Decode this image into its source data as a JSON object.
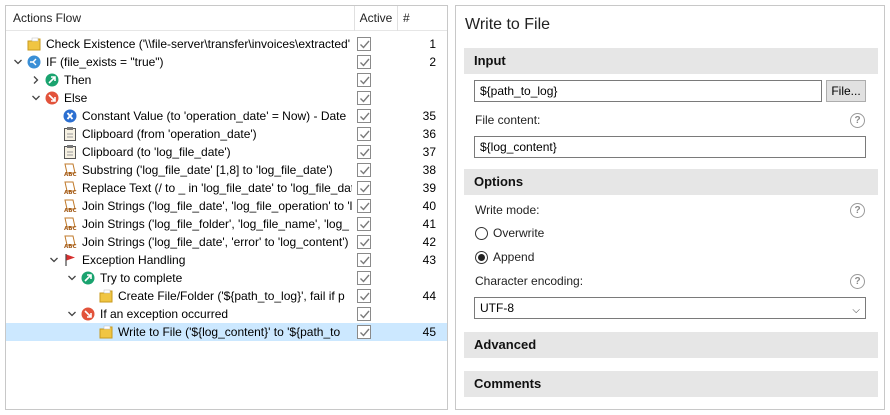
{
  "flow": {
    "headers": {
      "name": "Actions Flow",
      "active": "Active",
      "num": "#"
    },
    "rows": [
      {
        "label": "Check Existence ('\\\\file-server\\transfer\\invoices\\extracted'",
        "num": "1",
        "icon": "folder-icon",
        "indent": 0,
        "arrow": "",
        "selected": false
      },
      {
        "label": "IF (file_exists = \"true\")",
        "num": "2",
        "icon": "condition-icon",
        "indent": 0,
        "arrow": "expanded",
        "selected": false
      },
      {
        "label": "Then",
        "num": "",
        "icon": "then-icon",
        "indent": 1,
        "arrow": "collapsed",
        "selected": false
      },
      {
        "label": "Else",
        "num": "",
        "icon": "else-icon",
        "indent": 1,
        "arrow": "expanded",
        "selected": false
      },
      {
        "label": "Constant Value (to 'operation_date' = Now) - Date",
        "num": "35",
        "icon": "constant-icon",
        "indent": 2,
        "arrow": "",
        "selected": false
      },
      {
        "label": "Clipboard (from 'operation_date')",
        "num": "36",
        "icon": "clipboard-icon",
        "indent": 2,
        "arrow": "",
        "selected": false
      },
      {
        "label": "Clipboard (to 'log_file_date')",
        "num": "37",
        "icon": "clipboard-icon",
        "indent": 2,
        "arrow": "",
        "selected": false
      },
      {
        "label": "Substring ('log_file_date' [1,8] to 'log_file_date')",
        "num": "38",
        "icon": "string-icon",
        "indent": 2,
        "arrow": "",
        "selected": false
      },
      {
        "label": "Replace Text (/ to _ in 'log_file_date' to 'log_file_date')",
        "num": "39",
        "icon": "string-icon",
        "indent": 2,
        "arrow": "",
        "selected": false
      },
      {
        "label": "Join Strings ('log_file_date', 'log_file_operation' to 'log",
        "num": "40",
        "icon": "string-icon",
        "indent": 2,
        "arrow": "",
        "selected": false
      },
      {
        "label": "Join Strings ('log_file_folder', 'log_file_name', 'log_",
        "num": "41",
        "icon": "string-icon",
        "indent": 2,
        "arrow": "",
        "selected": false
      },
      {
        "label": "Join Strings ('log_file_date', 'error' to 'log_content')",
        "num": "42",
        "icon": "string-icon",
        "indent": 2,
        "arrow": "",
        "selected": false
      },
      {
        "label": "Exception Handling",
        "num": "43",
        "icon": "flag-icon",
        "indent": 2,
        "arrow": "expanded",
        "selected": false
      },
      {
        "label": "Try to complete",
        "num": "",
        "icon": "then-icon",
        "indent": 3,
        "arrow": "expanded",
        "selected": false
      },
      {
        "label": "Create File/Folder ('${path_to_log}', fail if p",
        "num": "44",
        "icon": "folder-icon",
        "indent": 4,
        "arrow": "",
        "selected": false
      },
      {
        "label": "If an exception occurred",
        "num": "",
        "icon": "else-icon",
        "indent": 3,
        "arrow": "expanded",
        "selected": false
      },
      {
        "label": "Write to File ('${log_content}' to '${path_to",
        "num": "45",
        "icon": "folder-icon",
        "indent": 4,
        "arrow": "",
        "selected": true
      }
    ]
  },
  "props": {
    "title": "Write to File",
    "input_section": "Input",
    "path_value": "${path_to_log}",
    "file_button": "File...",
    "file_content_label": "File content:",
    "file_content_value": "${log_content}",
    "options_section": "Options",
    "write_mode_label": "Write mode:",
    "overwrite_label": "Overwrite",
    "append_label": "Append",
    "write_mode_selected": "Append",
    "encoding_label": "Character encoding:",
    "encoding_value": "UTF-8",
    "advanced_section": "Advanced",
    "comments_section": "Comments",
    "help_glyph": "?"
  },
  "colors": {
    "selected_row": "#cce8ff",
    "section_bg": "#e6e6e6",
    "then_icon": "#1aa36f",
    "else_icon": "#e2533b",
    "condition_icon": "#3a8fd6",
    "constant_icon": "#2b6fd1",
    "flag_icon": "#d6302f"
  }
}
